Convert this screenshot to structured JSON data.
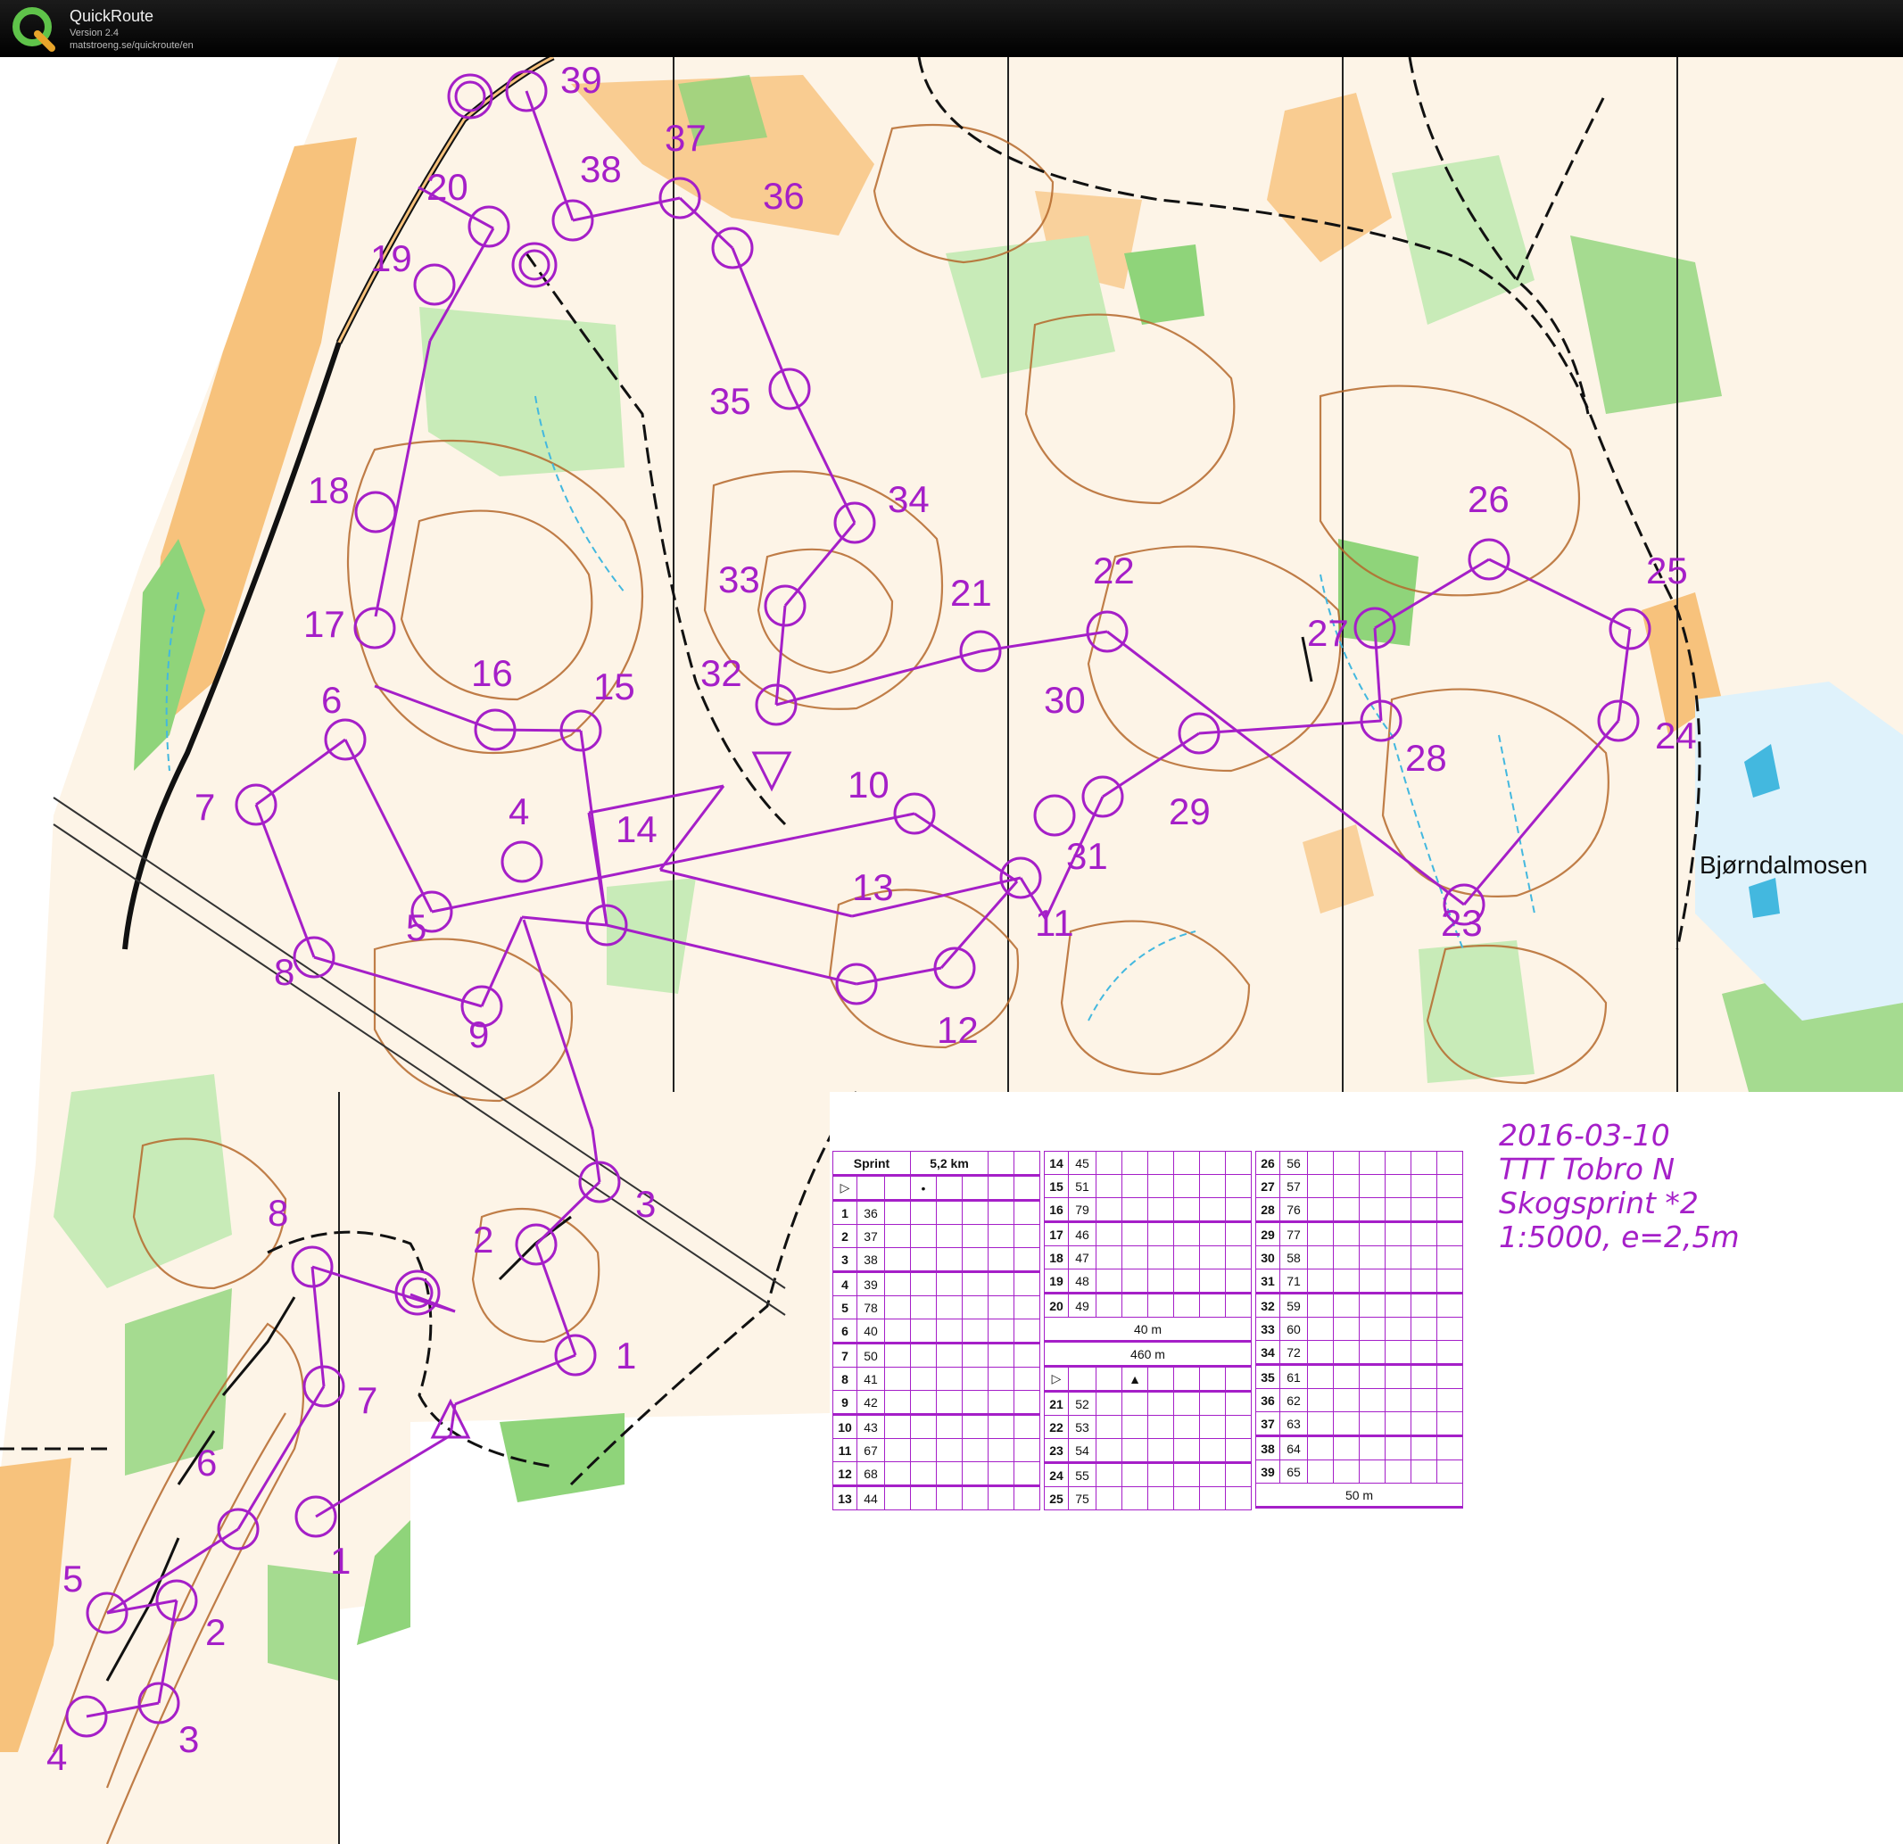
{
  "app": {
    "name": "QuickRoute",
    "version": "Version 2.4",
    "url": "matstroeng.se/quickroute/en",
    "logo_letter": "Q",
    "logo_icon": "quickroute-logo-icon"
  },
  "map": {
    "place_name": "Bjørndalmosen",
    "event_info": [
      "2016-03-10",
      "TTT Tobro N",
      "Skogsprint *2",
      "1:5000, e=2,5m"
    ],
    "course_color": "#a51fc8",
    "colors": {
      "forest": "#ffffff",
      "green": "#8fd47a",
      "light_green": "#c8ebb8",
      "open": "#f7c27c",
      "light_open": "#fde6c2",
      "contour": "#b5682c",
      "water": "#43b8df",
      "black": "#111111",
      "course": "#a51fc8"
    },
    "course_main_labels": [
      "39",
      "38",
      "37",
      "36",
      "35",
      "34",
      "33",
      "32",
      "21",
      "22",
      "20",
      "19",
      "18",
      "17",
      "16",
      "15",
      "6",
      "7",
      "5",
      "4",
      "14",
      "10",
      "8",
      "9",
      "13",
      "12",
      "11",
      "30",
      "31",
      "29",
      "28",
      "27",
      "26",
      "25",
      "24",
      "23"
    ],
    "course_small_labels": [
      "1",
      "2",
      "3",
      "4",
      "5",
      "6",
      "7",
      "8",
      "1",
      "2",
      "3"
    ]
  },
  "descriptions": {
    "main_header": {
      "name": "Sprint",
      "length": "5,2 km"
    },
    "main": [
      {
        "no": "1",
        "code": "36"
      },
      {
        "no": "2",
        "code": "37"
      },
      {
        "no": "3",
        "code": "38"
      },
      {
        "no": "4",
        "code": "39"
      },
      {
        "no": "5",
        "code": "78"
      },
      {
        "no": "6",
        "code": "40"
      },
      {
        "no": "7",
        "code": "50"
      },
      {
        "no": "8",
        "code": "41"
      },
      {
        "no": "9",
        "code": "42"
      },
      {
        "no": "10",
        "code": "43"
      },
      {
        "no": "11",
        "code": "67"
      },
      {
        "no": "12",
        "code": "68"
      },
      {
        "no": "13",
        "code": "44"
      },
      {
        "no": "14",
        "code": "45"
      },
      {
        "no": "15",
        "code": "51"
      },
      {
        "no": "16",
        "code": "79"
      },
      {
        "no": "17",
        "code": "46"
      },
      {
        "no": "18",
        "code": "47"
      },
      {
        "no": "19",
        "code": "48"
      },
      {
        "no": "20",
        "code": "49"
      },
      {
        "no": "21",
        "code": "52"
      },
      {
        "no": "22",
        "code": "53"
      },
      {
        "no": "23",
        "code": "54"
      },
      {
        "no": "24",
        "code": "55"
      },
      {
        "no": "25",
        "code": "75"
      },
      {
        "no": "26",
        "code": "56"
      },
      {
        "no": "27",
        "code": "57"
      },
      {
        "no": "28",
        "code": "76"
      },
      {
        "no": "29",
        "code": "77"
      },
      {
        "no": "30",
        "code": "58"
      },
      {
        "no": "31",
        "code": "71"
      },
      {
        "no": "32",
        "code": "59"
      },
      {
        "no": "33",
        "code": "60"
      },
      {
        "no": "34",
        "code": "72"
      },
      {
        "no": "35",
        "code": "61"
      },
      {
        "no": "36",
        "code": "62"
      },
      {
        "no": "37",
        "code": "63"
      },
      {
        "no": "38",
        "code": "64"
      },
      {
        "no": "39",
        "code": "65"
      }
    ],
    "tape_40": "40 m",
    "tape_460": "460 m",
    "tape_50": "50 m"
  }
}
